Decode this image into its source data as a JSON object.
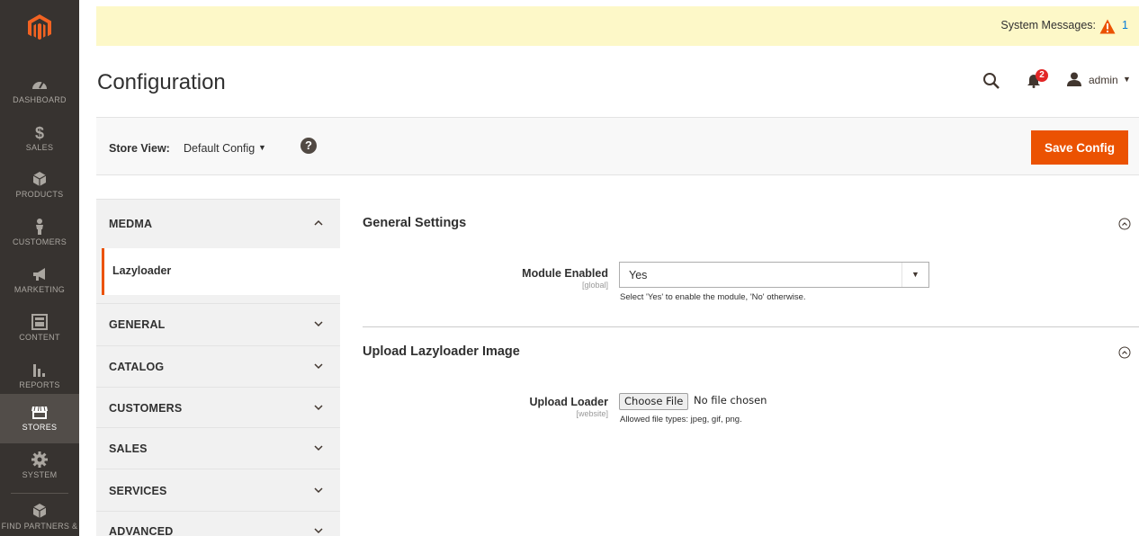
{
  "sidebar": {
    "logo": "magento-logo-icon",
    "items": [
      {
        "label": "DASHBOARD",
        "icon": "speedometer-icon",
        "active": false
      },
      {
        "label": "SALES",
        "icon": "dollar-icon",
        "active": false
      },
      {
        "label": "PRODUCTS",
        "icon": "cube-icon",
        "active": false
      },
      {
        "label": "CUSTOMERS",
        "icon": "person-icon",
        "active": false
      },
      {
        "label": "MARKETING",
        "icon": "megaphone-icon",
        "active": false
      },
      {
        "label": "CONTENT",
        "icon": "layout-icon",
        "active": false
      },
      {
        "label": "REPORTS",
        "icon": "bar-chart-icon",
        "active": false
      },
      {
        "label": "STORES",
        "icon": "store-icon",
        "active": true
      },
      {
        "label": "SYSTEM",
        "icon": "gear-icon",
        "active": false
      },
      {
        "label": "FIND PARTNERS &",
        "icon": "partner-cube-icon",
        "active": false
      }
    ]
  },
  "system_messages": {
    "label": "System Messages:",
    "count": "1",
    "icon": "warning-triangle-icon"
  },
  "header": {
    "title": "Configuration",
    "notification_count": "2",
    "user": "admin"
  },
  "actions": {
    "store_view_label": "Store View:",
    "store_view_value": "Default Config",
    "help": "?",
    "save_label": "Save Config"
  },
  "tabs": {
    "groups": [
      {
        "title": "MEDMA",
        "expanded": true
      },
      {
        "title": "GENERAL",
        "expanded": false
      },
      {
        "title": "CATALOG",
        "expanded": false
      },
      {
        "title": "CUSTOMERS",
        "expanded": false
      },
      {
        "title": "SALES",
        "expanded": false
      },
      {
        "title": "SERVICES",
        "expanded": false
      },
      {
        "title": "ADVANCED",
        "expanded": false
      }
    ],
    "active_item": "Lazyloader"
  },
  "sections": {
    "general": {
      "title": "General Settings",
      "field_label": "Module Enabled",
      "field_scope": "[global]",
      "field_value": "Yes",
      "field_note": "Select 'Yes' to enable the module, 'No' otherwise."
    },
    "upload": {
      "title": "Upload Lazyloader Image",
      "field_label": "Upload Loader",
      "field_scope": "[website]",
      "button_label": "Choose File",
      "status": "No file chosen",
      "field_note": "Allowed file types: jpeg, gif, png."
    }
  },
  "colors": {
    "accent": "#eb5202",
    "sidebar_bg": "#373330",
    "sysbar_bg": "#fdf8c8"
  }
}
